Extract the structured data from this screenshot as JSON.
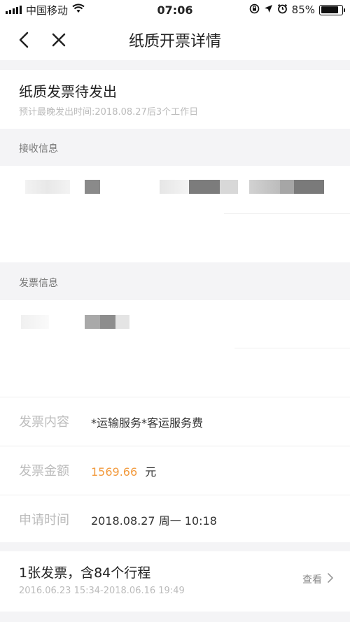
{
  "status_bar": {
    "carrier": "中国移动",
    "time": "07:06",
    "battery_percent": "85%",
    "battery_level": 0.85
  },
  "nav": {
    "title": "纸质开票详情",
    "back_icon": "chevron-left-icon",
    "close_icon": "close-icon"
  },
  "invoice_status": {
    "title": "纸质发票待发出",
    "subtitle": "预计最晚发出时间:2018.08.27后3个工作日"
  },
  "receive_section": {
    "label": "接收信息"
  },
  "invoice_section": {
    "label": "发票信息",
    "rows": [
      {
        "label": "发票内容",
        "value": "*运输服务*客运服务费"
      },
      {
        "label": "发票金额",
        "value": "1569.66",
        "unit": "元"
      },
      {
        "label": "申请时间",
        "value": "2018.08.27 周一 10:18"
      }
    ]
  },
  "trips": {
    "title": "1张发票，含84个行程",
    "range": "2016.06.23 15:34-2018.06.16 19:49",
    "view_label": "查看"
  },
  "colors": {
    "accent": "#f29a3d",
    "background": "#f4f4f6",
    "muted": "#bcbcbc"
  }
}
